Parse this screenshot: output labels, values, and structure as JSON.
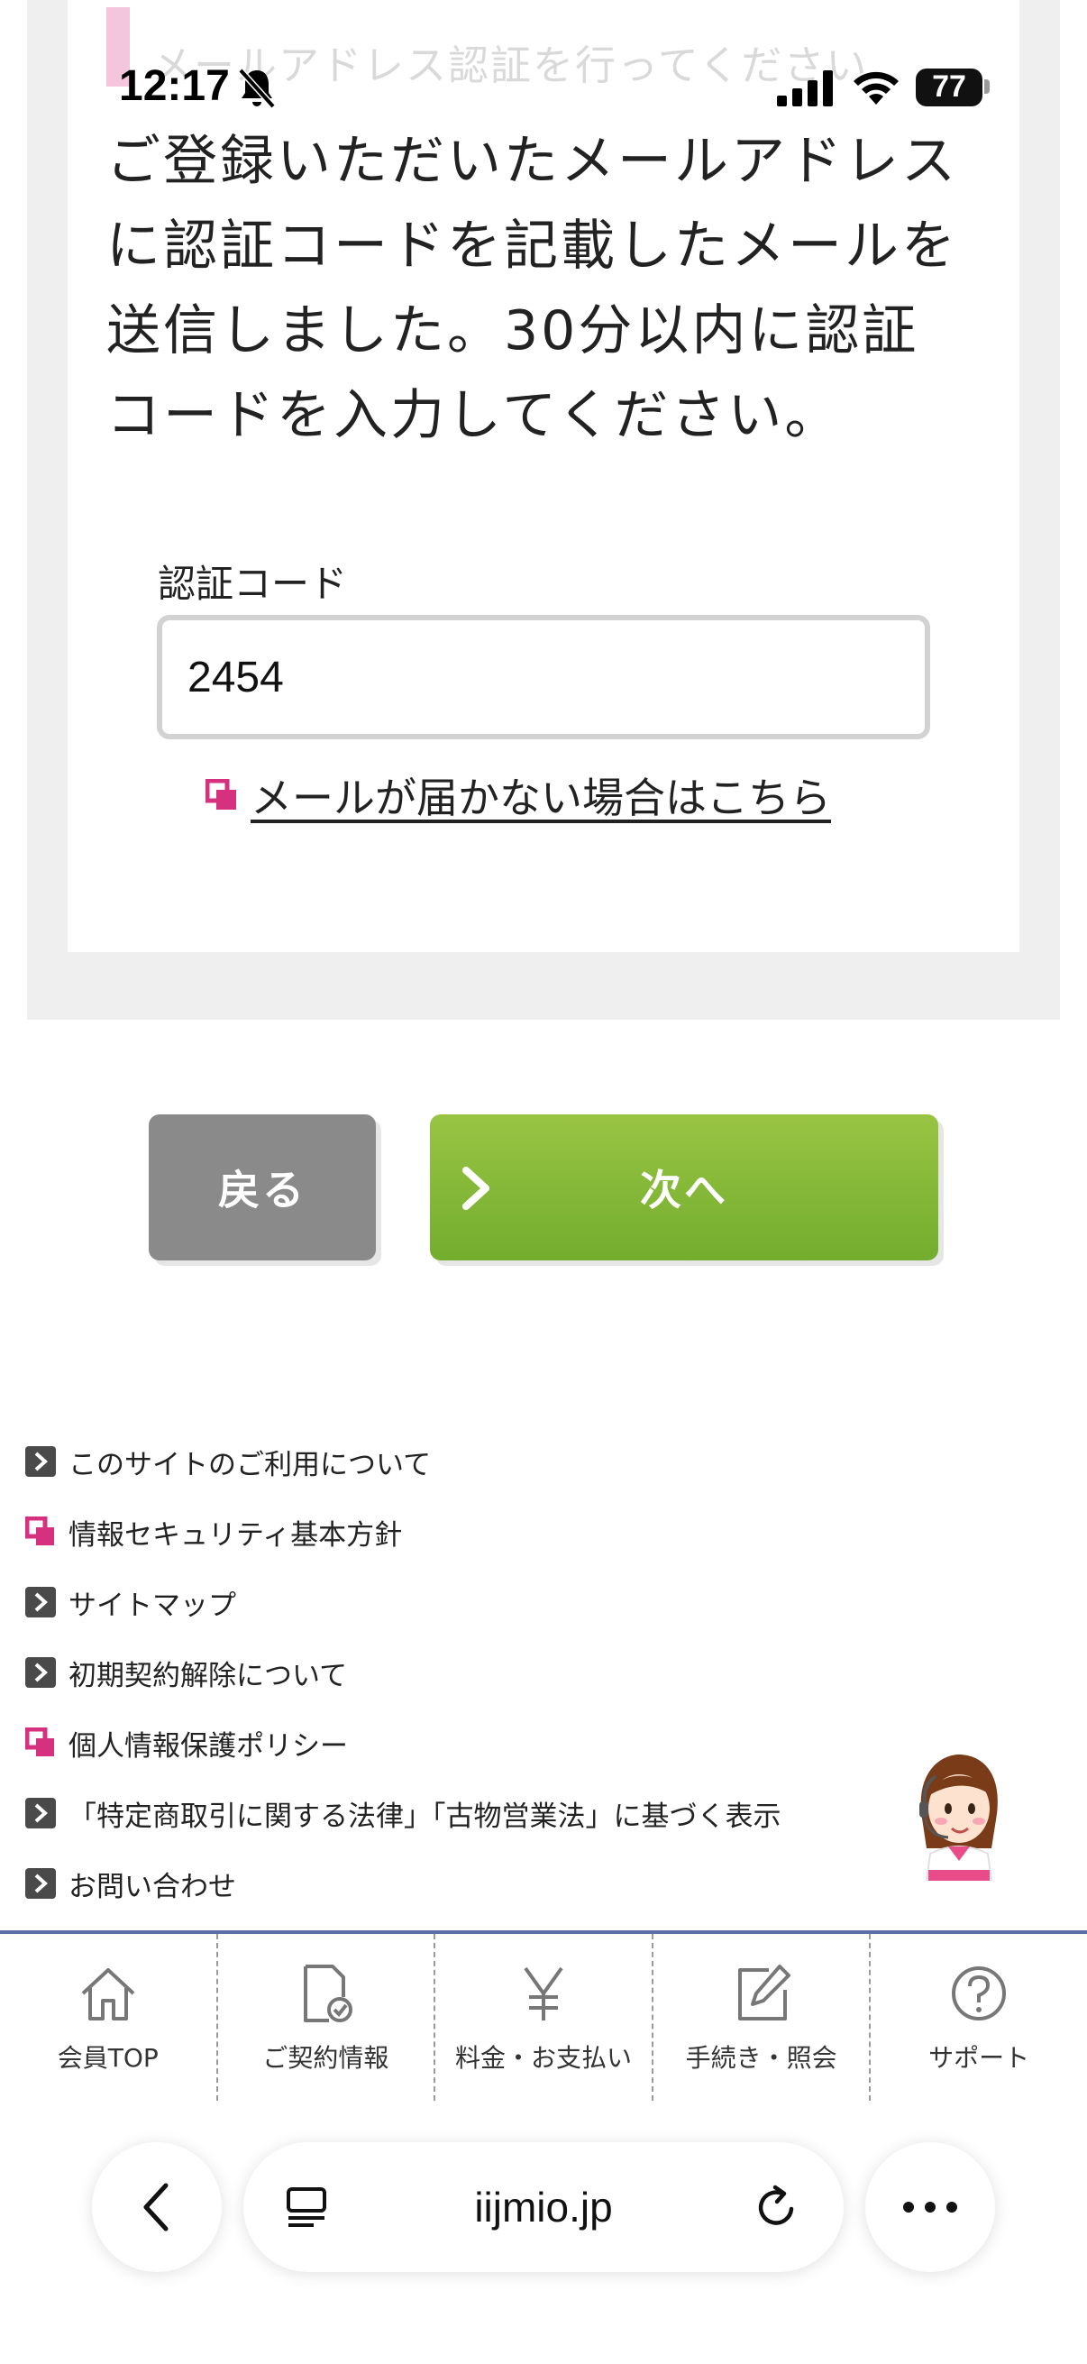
{
  "status_bar": {
    "time": "12:17",
    "battery": "77"
  },
  "form": {
    "section_heading": "メールアドレス認証を行ってください",
    "instruction": "ご登録いただいたメールアドレスに認証コードを記載したメールを送信しました。30分以内に認証コードを入力してください。",
    "code_label": "認証コード",
    "code_value": "2454",
    "mail_not_received_link": "メールが届かない場合はこちら"
  },
  "buttons": {
    "back_label": "戻る",
    "next_label": "次へ"
  },
  "footer": {
    "links": [
      {
        "label": "このサイトのご利用について",
        "icon": "arrow-icon"
      },
      {
        "label": "情報セキュリティ基本方針",
        "icon": "external-link-icon"
      },
      {
        "label": "サイトマップ",
        "icon": "arrow-icon"
      },
      {
        "label": "初期契約解除について",
        "icon": "arrow-icon"
      },
      {
        "label": "個人情報保護ポリシー",
        "icon": "external-link-icon"
      },
      {
        "label": "「特定商取引に関する法律」「古物営業法」に基づく表示",
        "icon": "arrow-icon"
      },
      {
        "label": "お問い合わせ",
        "icon": "arrow-icon"
      }
    ]
  },
  "bottom_nav": {
    "items": [
      {
        "label": "会員TOP",
        "icon": "home-icon"
      },
      {
        "label": "ご契約情報",
        "icon": "contract-document-icon"
      },
      {
        "label": "料金・お支払い",
        "icon": "yen-icon"
      },
      {
        "label": "手続き・照会",
        "icon": "edit-icon"
      },
      {
        "label": "サポート",
        "icon": "help-icon"
      }
    ]
  },
  "browser": {
    "url": "iijmio.jp"
  },
  "colors": {
    "accent_green": "#7db535",
    "back_gray": "#8a8a8a",
    "link_pink": "#d6317f",
    "nav_line_blue": "#5a6fa8"
  }
}
